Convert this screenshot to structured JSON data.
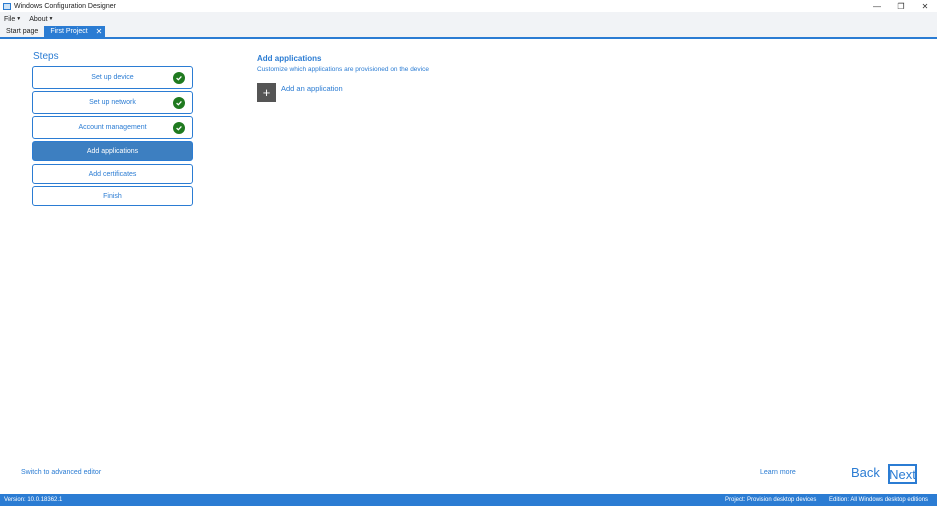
{
  "window": {
    "title": "Windows Configuration Designer",
    "controls": [
      "—",
      "❐",
      "✕"
    ]
  },
  "menu": {
    "items": [
      {
        "label": "File"
      },
      {
        "label": "About"
      }
    ]
  },
  "tabs": [
    {
      "label": "Start page",
      "active": false
    },
    {
      "label": "First Project",
      "active": true,
      "close": "✕"
    }
  ],
  "steps": {
    "title": "Steps",
    "items": [
      {
        "label": "Set up device",
        "completed": true
      },
      {
        "label": "Set up network",
        "completed": true
      },
      {
        "label": "Account management",
        "completed": true
      },
      {
        "label": "Add applications",
        "completed": false,
        "active": true
      },
      {
        "label": "Add certificates",
        "completed": false
      },
      {
        "label": "Finish",
        "completed": false
      }
    ]
  },
  "main": {
    "title": "Add applications",
    "subtitle": "Customize which applications are provisioned on the device",
    "add_button_icon": "+",
    "add_label": "Add an application"
  },
  "footer": {
    "advanced_link": "Switch to advanced editor",
    "learn_more": "Learn more",
    "back": "Back",
    "next": "Next"
  },
  "status": {
    "version": "Version: 10.0.18362.1",
    "project": "Project: Provision desktop devices",
    "edition": "Edition: All Windows desktop editions"
  },
  "colors": {
    "accent": "#2b7cd3",
    "active_step": "#3d7fc1",
    "check_green": "#1f7a1f"
  }
}
